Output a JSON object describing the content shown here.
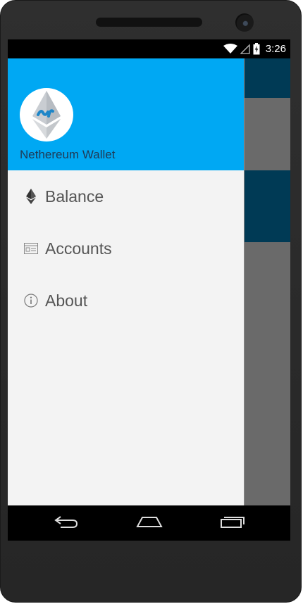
{
  "status_bar": {
    "time": "3:26",
    "icons": [
      "wifi-icon",
      "signal-icon",
      "battery-icon"
    ]
  },
  "drawer": {
    "app_name": "Nethereum Wallet",
    "header_color": "#00a8f3",
    "items": [
      {
        "label": "Balance",
        "icon": "ethereum-icon"
      },
      {
        "label": "Accounts",
        "icon": "accounts-icon"
      },
      {
        "label": "About",
        "icon": "info-icon"
      }
    ]
  },
  "nav_bar": {
    "buttons": [
      "back-icon",
      "home-icon",
      "recents-icon"
    ]
  },
  "colors": {
    "background_app_toolbar": "#003a55",
    "scrim": "#686868",
    "drawer_bg": "#f3f3f3"
  }
}
